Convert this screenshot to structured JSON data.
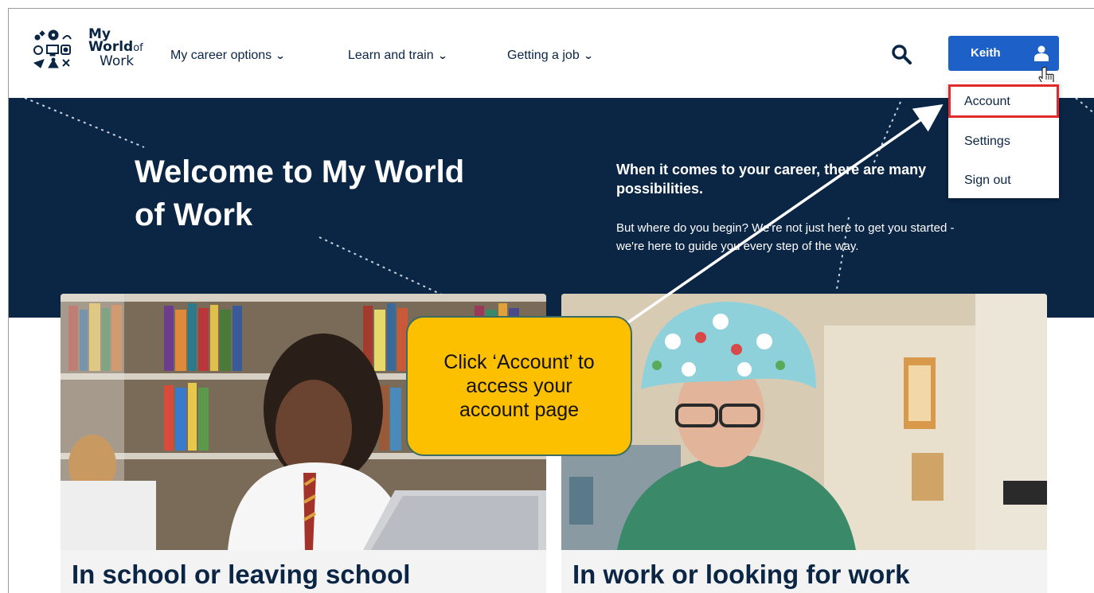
{
  "header": {
    "logo": {
      "line1": "My",
      "line2_main": "World",
      "line2_suffix": "of",
      "line3": "Work"
    },
    "nav": [
      {
        "label": "My career options"
      },
      {
        "label": "Learn and train"
      },
      {
        "label": "Getting a job"
      }
    ],
    "search_icon": "search-icon",
    "user_button": {
      "label": "Keith",
      "icon": "user-icon"
    }
  },
  "dropdown": {
    "items": [
      {
        "label": "Account",
        "highlighted": true
      },
      {
        "label": "Settings"
      },
      {
        "label": "Sign out"
      }
    ]
  },
  "hero": {
    "title": "Welcome to My World of Work",
    "subtitle": "When it comes to your career, there are many possibilities.",
    "body": "But where do you begin? We're not just here to get you started - we're here to guide you every step of the way."
  },
  "cards": [
    {
      "title": "In school or leaving school"
    },
    {
      "title": "In work or looking for work"
    }
  ],
  "annotation": {
    "callout_text": "Click ‘Account’ to access your account page",
    "colors": {
      "callout_bg": "#fdc000",
      "highlight_border": "#e22a2a",
      "arrow": "#ffffff"
    }
  },
  "colors": {
    "navy": "#0b2545",
    "brand_blue": "#1d61c8"
  }
}
